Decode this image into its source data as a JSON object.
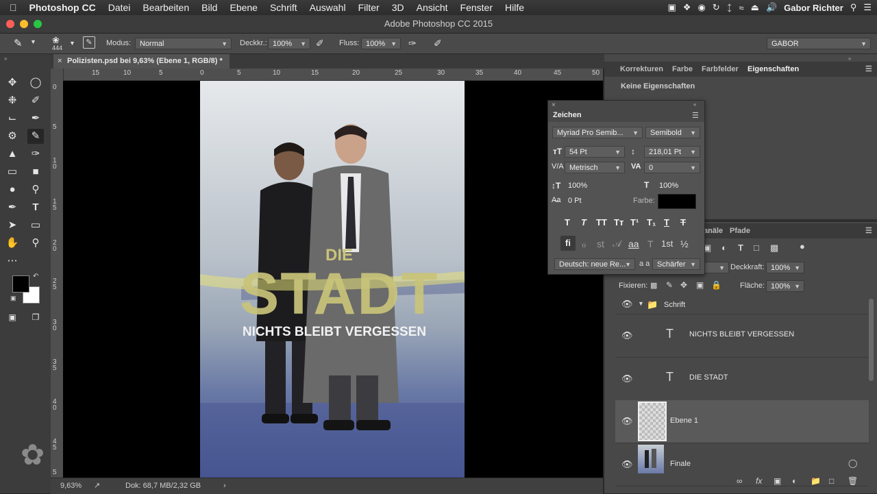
{
  "menubar": {
    "app_name": "Photoshop CC",
    "items": [
      "Datei",
      "Bearbeiten",
      "Bild",
      "Ebene",
      "Schrift",
      "Auswahl",
      "Filter",
      "3D",
      "Ansicht",
      "Fenster",
      "Hilfe"
    ],
    "user": "Gabor Richter"
  },
  "window": {
    "title": "Adobe Photoshop CC 2015"
  },
  "options": {
    "brush_size": "444",
    "modus_label": "Modus:",
    "modus_value": "Normal",
    "deckkr_label": "Deckkr.:",
    "deckkr_value": "100%",
    "fluss_label": "Fluss:",
    "fluss_value": "100%",
    "workspace": "GABOR"
  },
  "document": {
    "tab_title": "Polizisten.psd bei 9,63% (Ebene 1, RGB/8) *",
    "zoom": "9,63%",
    "doc_info": "Dok: 68,7 MB/2,32 GB"
  },
  "rulers": {
    "h_ticks": [
      "15",
      "10",
      "5",
      "0",
      "5",
      "10",
      "15",
      "20",
      "25",
      "30",
      "35",
      "40",
      "45",
      "50"
    ],
    "v_ticks": [
      "0",
      "5",
      "1\n0",
      "1\n5",
      "2\n0",
      "2\n5",
      "3\n0",
      "3\n5",
      "4\n0",
      "4\n5",
      "5"
    ]
  },
  "poster": {
    "title_small": "DIE",
    "title_big": "STADT",
    "subtitle": "NICHTS BLEIBT VERGESSEN"
  },
  "top_panel": {
    "tabs": [
      "Korrekturen",
      "Farbe",
      "Farbfelder",
      "Eigenschaften"
    ],
    "active_tab": "Eigenschaften",
    "content": "Keine Eigenschaften"
  },
  "zeichen": {
    "title": "Zeichen",
    "font_family": "Myriad Pro Semib...",
    "font_style": "Semibold",
    "size": "54 Pt",
    "leading": "218,01 Pt",
    "kerning": "Metrisch",
    "tracking": "0",
    "vscale": "100%",
    "hscale": "100%",
    "baseline": "0 Pt",
    "farbe_label": "Farbe:",
    "color": "#000000",
    "style_buttons": [
      "T",
      "T",
      "TT",
      "Tт",
      "T¹",
      "T₁",
      "T",
      "T"
    ],
    "opentype_buttons": [
      "fi",
      "ℴ",
      "st",
      "𝒜",
      "aa",
      "T",
      "1st",
      "½"
    ],
    "language": "Deutsch: neue Re...",
    "aa_label": "a a",
    "antialias": "Schärfer"
  },
  "layers_panel": {
    "tabs_partial": "anäle",
    "pfade": "Pfade",
    "deckkraft_label": "Deckkraft:",
    "deckkraft_value": "100%",
    "fixieren_label": "Fixieren:",
    "flaeche_label": "Fläche:",
    "flaeche_value": "100%",
    "layers": [
      {
        "name": "Schrift",
        "kind": "group"
      },
      {
        "name": "NICHTS BLEIBT VERGESSEN",
        "kind": "text"
      },
      {
        "name": "DIE STADT",
        "kind": "text"
      },
      {
        "name": "Ebene 1",
        "kind": "pixel",
        "selected": true
      },
      {
        "name": "Finale",
        "kind": "smart"
      }
    ]
  },
  "colors": {
    "accent_text": "#c9c47a",
    "selected_layer": "#5a5a5a"
  }
}
